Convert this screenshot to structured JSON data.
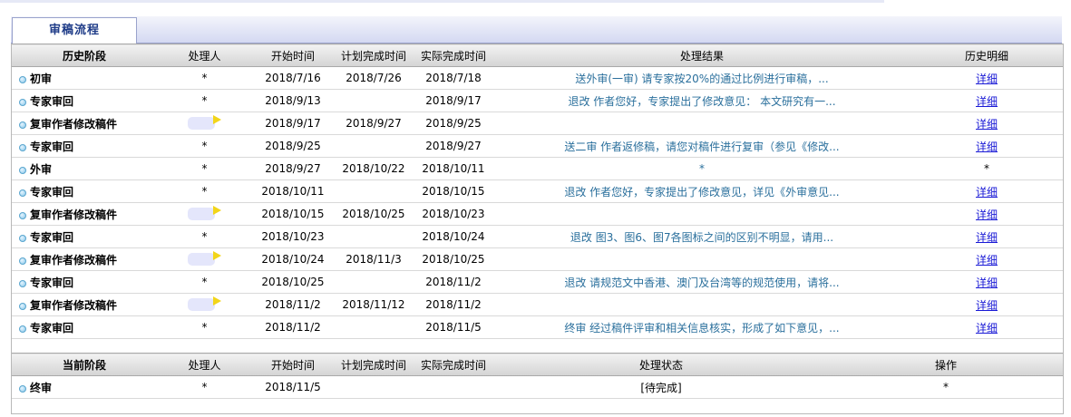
{
  "tab": {
    "label": "审稿流程"
  },
  "history": {
    "headers": [
      "历史阶段",
      "处理人",
      "开始时间",
      "计划完成时间",
      "实际完成时间",
      "处理结果",
      "历史明细"
    ],
    "rows": [
      {
        "stage": "初审",
        "handler": "*",
        "start": "2018/7/16",
        "planned": "2018/7/26",
        "actual": "2018/7/18",
        "result": "送外审(一审) 请专家按20%的通过比例进行审稿，...",
        "detail": "详细"
      },
      {
        "stage": "专家审回",
        "handler": "*",
        "start": "2018/9/13",
        "planned": "",
        "actual": "2018/9/17",
        "result": "退改 作者您好，专家提出了修改意见： 本文研究有一...",
        "detail": "详细"
      },
      {
        "stage": "复审作者修改稿件",
        "handler": "",
        "start": "2018/9/17",
        "planned": "2018/9/27",
        "actual": "2018/9/25",
        "result": "",
        "detail": "详细"
      },
      {
        "stage": "专家审回",
        "handler": "*",
        "start": "2018/9/25",
        "planned": "",
        "actual": "2018/9/27",
        "result": "送二审 作者返修稿，请您对稿件进行复审（参见《修改...",
        "detail": "详细"
      },
      {
        "stage": "外审",
        "handler": "*",
        "start": "2018/9/27",
        "planned": "2018/10/22",
        "actual": "2018/10/11",
        "result": "*",
        "detail": "*"
      },
      {
        "stage": "专家审回",
        "handler": "*",
        "start": "2018/10/11",
        "planned": "",
        "actual": "2018/10/15",
        "result": "退改 作者您好，专家提出了修改意见，详见《外审意见...",
        "detail": "详细"
      },
      {
        "stage": "复审作者修改稿件",
        "handler": "",
        "start": "2018/10/15",
        "planned": "2018/10/25",
        "actual": "2018/10/23",
        "result": "",
        "detail": "详细"
      },
      {
        "stage": "专家审回",
        "handler": "*",
        "start": "2018/10/23",
        "planned": "",
        "actual": "2018/10/24",
        "result": "退改 图3、图6、图7各图标之间的区别不明显，请用...",
        "detail": "详细"
      },
      {
        "stage": "复审作者修改稿件",
        "handler": "",
        "start": "2018/10/24",
        "planned": "2018/11/3",
        "actual": "2018/10/25",
        "result": "",
        "detail": "详细"
      },
      {
        "stage": "专家审回",
        "handler": "*",
        "start": "2018/10/25",
        "planned": "",
        "actual": "2018/11/2",
        "result": "退改 请规范文中香港、澳门及台湾等的规范使用，请将...",
        "detail": "详细"
      },
      {
        "stage": "复审作者修改稿件",
        "handler": "",
        "start": "2018/11/2",
        "planned": "2018/11/12",
        "actual": "2018/11/2",
        "result": "",
        "detail": "详细"
      },
      {
        "stage": "专家审回",
        "handler": "*",
        "start": "2018/11/2",
        "planned": "",
        "actual": "2018/11/5",
        "result": "终审 经过稿件评审和相关信息核实，形成了如下意见，...",
        "detail": "详细"
      }
    ]
  },
  "current": {
    "headers": [
      "当前阶段",
      "处理人",
      "开始时间",
      "计划完成时间",
      "实际完成时间",
      "处理状态",
      "操作"
    ],
    "rows": [
      {
        "stage": "终审",
        "handler": "*",
        "start": "2018/11/5",
        "planned": "",
        "actual": "",
        "status": "[待完成]",
        "operation": "*"
      }
    ]
  }
}
